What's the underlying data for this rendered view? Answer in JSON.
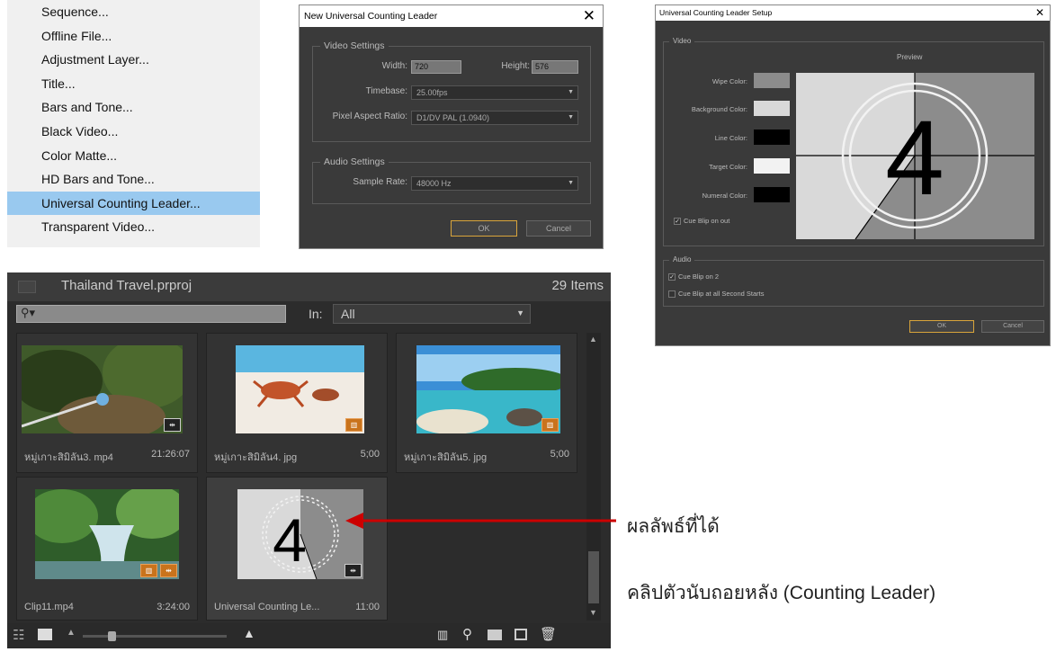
{
  "menu": {
    "items": [
      {
        "label": "Sequence..."
      },
      {
        "label": "Offline File..."
      },
      {
        "label": "Adjustment Layer..."
      },
      {
        "label": "Title..."
      },
      {
        "label": "Bars and Tone..."
      },
      {
        "label": "Black Video..."
      },
      {
        "label": "Color Matte..."
      },
      {
        "label": "HD Bars and Tone..."
      },
      {
        "label": "Universal Counting Leader...",
        "selected": true
      },
      {
        "label": "Transparent Video..."
      }
    ]
  },
  "new_dialog": {
    "title": "New Universal Counting Leader",
    "close": "✕",
    "video_settings": {
      "title": "Video Settings",
      "width_label": "Width:",
      "width": "720",
      "height_label": "Height:",
      "height": "576",
      "timebase_label": "Timebase:",
      "timebase": "25.00fps",
      "par_label": "Pixel Aspect Ratio:",
      "par": "D1/DV PAL (1.0940)"
    },
    "audio_settings": {
      "title": "Audio Settings",
      "sample_rate_label": "Sample Rate:",
      "sample_rate": "48000 Hz"
    },
    "ok": "OK",
    "cancel": "Cancel"
  },
  "setup_dialog": {
    "title": "Universal Counting Leader Setup",
    "close": "✕",
    "video_group": "Video",
    "preview_label": "Preview",
    "numeral": "4",
    "colors": [
      {
        "label": "Wipe Color:",
        "color": "#8c8c8c"
      },
      {
        "label": "Background Color:",
        "color": "#d9d9d9"
      },
      {
        "label": "Line Color:",
        "color": "#000000"
      },
      {
        "label": "Target Color:",
        "color": "#f2f2f2"
      },
      {
        "label": "Numeral Color:",
        "color": "#000000"
      }
    ],
    "cue_blip_out": {
      "label": "Cue Blip on out",
      "checked": true
    },
    "audio_group": "Audio",
    "cue_blip_2": {
      "label": "Cue Blip on 2",
      "checked": true
    },
    "cue_blip_all": {
      "label": "Cue Blip at all Second Starts",
      "checked": false
    },
    "ok": "OK",
    "cancel": "Cancel"
  },
  "project": {
    "title": "Thailand Travel.prproj",
    "count": "29 Items",
    "search_placeholder": "",
    "in_label": "In:",
    "in_value": "All",
    "items": [
      {
        "name": "หมู่เกาะสิมิลัน3. mp4",
        "duration": "21:26:07"
      },
      {
        "name": "หมู่เกาะสิมิลัน4. jpg",
        "duration": "5;00"
      },
      {
        "name": "หมู่เกาะสิมิลัน5. jpg",
        "duration": "5;00"
      },
      {
        "name": "Clip11.mp4",
        "duration": "3:24:00"
      },
      {
        "name": "Universal Counting Le...",
        "duration": "11:00"
      }
    ],
    "leader_numeral": "4"
  },
  "annotation": {
    "result": "ผลลัพธ์ที่ได้",
    "caption": "คลิปตัวนับถอยหลัง (Counting Leader)",
    "arrow_color": "#cc0000"
  }
}
